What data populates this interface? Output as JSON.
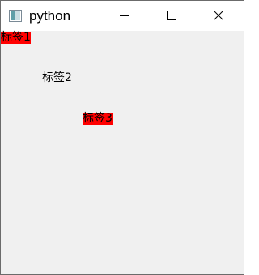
{
  "window": {
    "title": "python",
    "app_icon": "python-app-icon",
    "controls": [
      "minimize-icon",
      "maximize-icon",
      "close-icon"
    ]
  },
  "labels": [
    {
      "text": "标签1",
      "background": "#ff0000"
    },
    {
      "text": "标签2",
      "background": "transparent"
    },
    {
      "text": "标签3",
      "background": "#ff0000"
    }
  ],
  "colors": {
    "client_background": "#f0f0f0",
    "titlebar_background": "#ffffff",
    "label_highlight": "#ff0000"
  }
}
